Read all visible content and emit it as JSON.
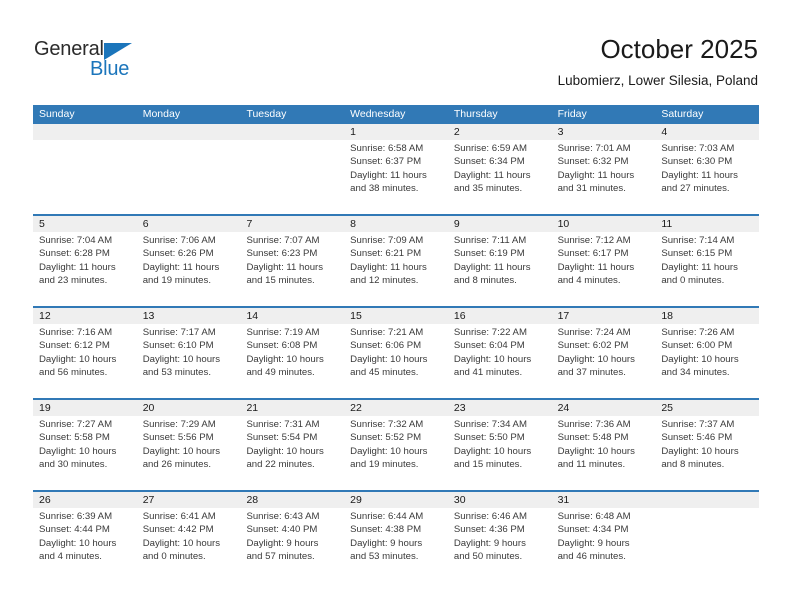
{
  "logo": {
    "word_one": "General",
    "word_two": "Blue",
    "triangle_color": "#1b75bb",
    "text_color": "#2b2b2b"
  },
  "header": {
    "title": "October 2025",
    "subtitle": "Lubomierz, Lower Silesia, Poland"
  },
  "theme": {
    "header_blue": "#3179b6",
    "daynum_band": "#efefef",
    "cell_background": "#ffffff",
    "body_text": "#3a3a3a"
  },
  "weekdays": [
    "Sunday",
    "Monday",
    "Tuesday",
    "Wednesday",
    "Thursday",
    "Friday",
    "Saturday"
  ],
  "weeks": [
    [
      {
        "day": "",
        "sunrise": "",
        "sunset": "",
        "daylight_line1": "",
        "daylight_line2": ""
      },
      {
        "day": "",
        "sunrise": "",
        "sunset": "",
        "daylight_line1": "",
        "daylight_line2": ""
      },
      {
        "day": "",
        "sunrise": "",
        "sunset": "",
        "daylight_line1": "",
        "daylight_line2": ""
      },
      {
        "day": "1",
        "sunrise": "Sunrise: 6:58 AM",
        "sunset": "Sunset: 6:37 PM",
        "daylight_line1": "Daylight: 11 hours",
        "daylight_line2": "and 38 minutes."
      },
      {
        "day": "2",
        "sunrise": "Sunrise: 6:59 AM",
        "sunset": "Sunset: 6:34 PM",
        "daylight_line1": "Daylight: 11 hours",
        "daylight_line2": "and 35 minutes."
      },
      {
        "day": "3",
        "sunrise": "Sunrise: 7:01 AM",
        "sunset": "Sunset: 6:32 PM",
        "daylight_line1": "Daylight: 11 hours",
        "daylight_line2": "and 31 minutes."
      },
      {
        "day": "4",
        "sunrise": "Sunrise: 7:03 AM",
        "sunset": "Sunset: 6:30 PM",
        "daylight_line1": "Daylight: 11 hours",
        "daylight_line2": "and 27 minutes."
      }
    ],
    [
      {
        "day": "5",
        "sunrise": "Sunrise: 7:04 AM",
        "sunset": "Sunset: 6:28 PM",
        "daylight_line1": "Daylight: 11 hours",
        "daylight_line2": "and 23 minutes."
      },
      {
        "day": "6",
        "sunrise": "Sunrise: 7:06 AM",
        "sunset": "Sunset: 6:26 PM",
        "daylight_line1": "Daylight: 11 hours",
        "daylight_line2": "and 19 minutes."
      },
      {
        "day": "7",
        "sunrise": "Sunrise: 7:07 AM",
        "sunset": "Sunset: 6:23 PM",
        "daylight_line1": "Daylight: 11 hours",
        "daylight_line2": "and 15 minutes."
      },
      {
        "day": "8",
        "sunrise": "Sunrise: 7:09 AM",
        "sunset": "Sunset: 6:21 PM",
        "daylight_line1": "Daylight: 11 hours",
        "daylight_line2": "and 12 minutes."
      },
      {
        "day": "9",
        "sunrise": "Sunrise: 7:11 AM",
        "sunset": "Sunset: 6:19 PM",
        "daylight_line1": "Daylight: 11 hours",
        "daylight_line2": "and 8 minutes."
      },
      {
        "day": "10",
        "sunrise": "Sunrise: 7:12 AM",
        "sunset": "Sunset: 6:17 PM",
        "daylight_line1": "Daylight: 11 hours",
        "daylight_line2": "and 4 minutes."
      },
      {
        "day": "11",
        "sunrise": "Sunrise: 7:14 AM",
        "sunset": "Sunset: 6:15 PM",
        "daylight_line1": "Daylight: 11 hours",
        "daylight_line2": "and 0 minutes."
      }
    ],
    [
      {
        "day": "12",
        "sunrise": "Sunrise: 7:16 AM",
        "sunset": "Sunset: 6:12 PM",
        "daylight_line1": "Daylight: 10 hours",
        "daylight_line2": "and 56 minutes."
      },
      {
        "day": "13",
        "sunrise": "Sunrise: 7:17 AM",
        "sunset": "Sunset: 6:10 PM",
        "daylight_line1": "Daylight: 10 hours",
        "daylight_line2": "and 53 minutes."
      },
      {
        "day": "14",
        "sunrise": "Sunrise: 7:19 AM",
        "sunset": "Sunset: 6:08 PM",
        "daylight_line1": "Daylight: 10 hours",
        "daylight_line2": "and 49 minutes."
      },
      {
        "day": "15",
        "sunrise": "Sunrise: 7:21 AM",
        "sunset": "Sunset: 6:06 PM",
        "daylight_line1": "Daylight: 10 hours",
        "daylight_line2": "and 45 minutes."
      },
      {
        "day": "16",
        "sunrise": "Sunrise: 7:22 AM",
        "sunset": "Sunset: 6:04 PM",
        "daylight_line1": "Daylight: 10 hours",
        "daylight_line2": "and 41 minutes."
      },
      {
        "day": "17",
        "sunrise": "Sunrise: 7:24 AM",
        "sunset": "Sunset: 6:02 PM",
        "daylight_line1": "Daylight: 10 hours",
        "daylight_line2": "and 37 minutes."
      },
      {
        "day": "18",
        "sunrise": "Sunrise: 7:26 AM",
        "sunset": "Sunset: 6:00 PM",
        "daylight_line1": "Daylight: 10 hours",
        "daylight_line2": "and 34 minutes."
      }
    ],
    [
      {
        "day": "19",
        "sunrise": "Sunrise: 7:27 AM",
        "sunset": "Sunset: 5:58 PM",
        "daylight_line1": "Daylight: 10 hours",
        "daylight_line2": "and 30 minutes."
      },
      {
        "day": "20",
        "sunrise": "Sunrise: 7:29 AM",
        "sunset": "Sunset: 5:56 PM",
        "daylight_line1": "Daylight: 10 hours",
        "daylight_line2": "and 26 minutes."
      },
      {
        "day": "21",
        "sunrise": "Sunrise: 7:31 AM",
        "sunset": "Sunset: 5:54 PM",
        "daylight_line1": "Daylight: 10 hours",
        "daylight_line2": "and 22 minutes."
      },
      {
        "day": "22",
        "sunrise": "Sunrise: 7:32 AM",
        "sunset": "Sunset: 5:52 PM",
        "daylight_line1": "Daylight: 10 hours",
        "daylight_line2": "and 19 minutes."
      },
      {
        "day": "23",
        "sunrise": "Sunrise: 7:34 AM",
        "sunset": "Sunset: 5:50 PM",
        "daylight_line1": "Daylight: 10 hours",
        "daylight_line2": "and 15 minutes."
      },
      {
        "day": "24",
        "sunrise": "Sunrise: 7:36 AM",
        "sunset": "Sunset: 5:48 PM",
        "daylight_line1": "Daylight: 10 hours",
        "daylight_line2": "and 11 minutes."
      },
      {
        "day": "25",
        "sunrise": "Sunrise: 7:37 AM",
        "sunset": "Sunset: 5:46 PM",
        "daylight_line1": "Daylight: 10 hours",
        "daylight_line2": "and 8 minutes."
      }
    ],
    [
      {
        "day": "26",
        "sunrise": "Sunrise: 6:39 AM",
        "sunset": "Sunset: 4:44 PM",
        "daylight_line1": "Daylight: 10 hours",
        "daylight_line2": "and 4 minutes."
      },
      {
        "day": "27",
        "sunrise": "Sunrise: 6:41 AM",
        "sunset": "Sunset: 4:42 PM",
        "daylight_line1": "Daylight: 10 hours",
        "daylight_line2": "and 0 minutes."
      },
      {
        "day": "28",
        "sunrise": "Sunrise: 6:43 AM",
        "sunset": "Sunset: 4:40 PM",
        "daylight_line1": "Daylight: 9 hours",
        "daylight_line2": "and 57 minutes."
      },
      {
        "day": "29",
        "sunrise": "Sunrise: 6:44 AM",
        "sunset": "Sunset: 4:38 PM",
        "daylight_line1": "Daylight: 9 hours",
        "daylight_line2": "and 53 minutes."
      },
      {
        "day": "30",
        "sunrise": "Sunrise: 6:46 AM",
        "sunset": "Sunset: 4:36 PM",
        "daylight_line1": "Daylight: 9 hours",
        "daylight_line2": "and 50 minutes."
      },
      {
        "day": "31",
        "sunrise": "Sunrise: 6:48 AM",
        "sunset": "Sunset: 4:34 PM",
        "daylight_line1": "Daylight: 9 hours",
        "daylight_line2": "and 46 minutes."
      },
      {
        "day": "",
        "sunrise": "",
        "sunset": "",
        "daylight_line1": "",
        "daylight_line2": ""
      }
    ]
  ]
}
